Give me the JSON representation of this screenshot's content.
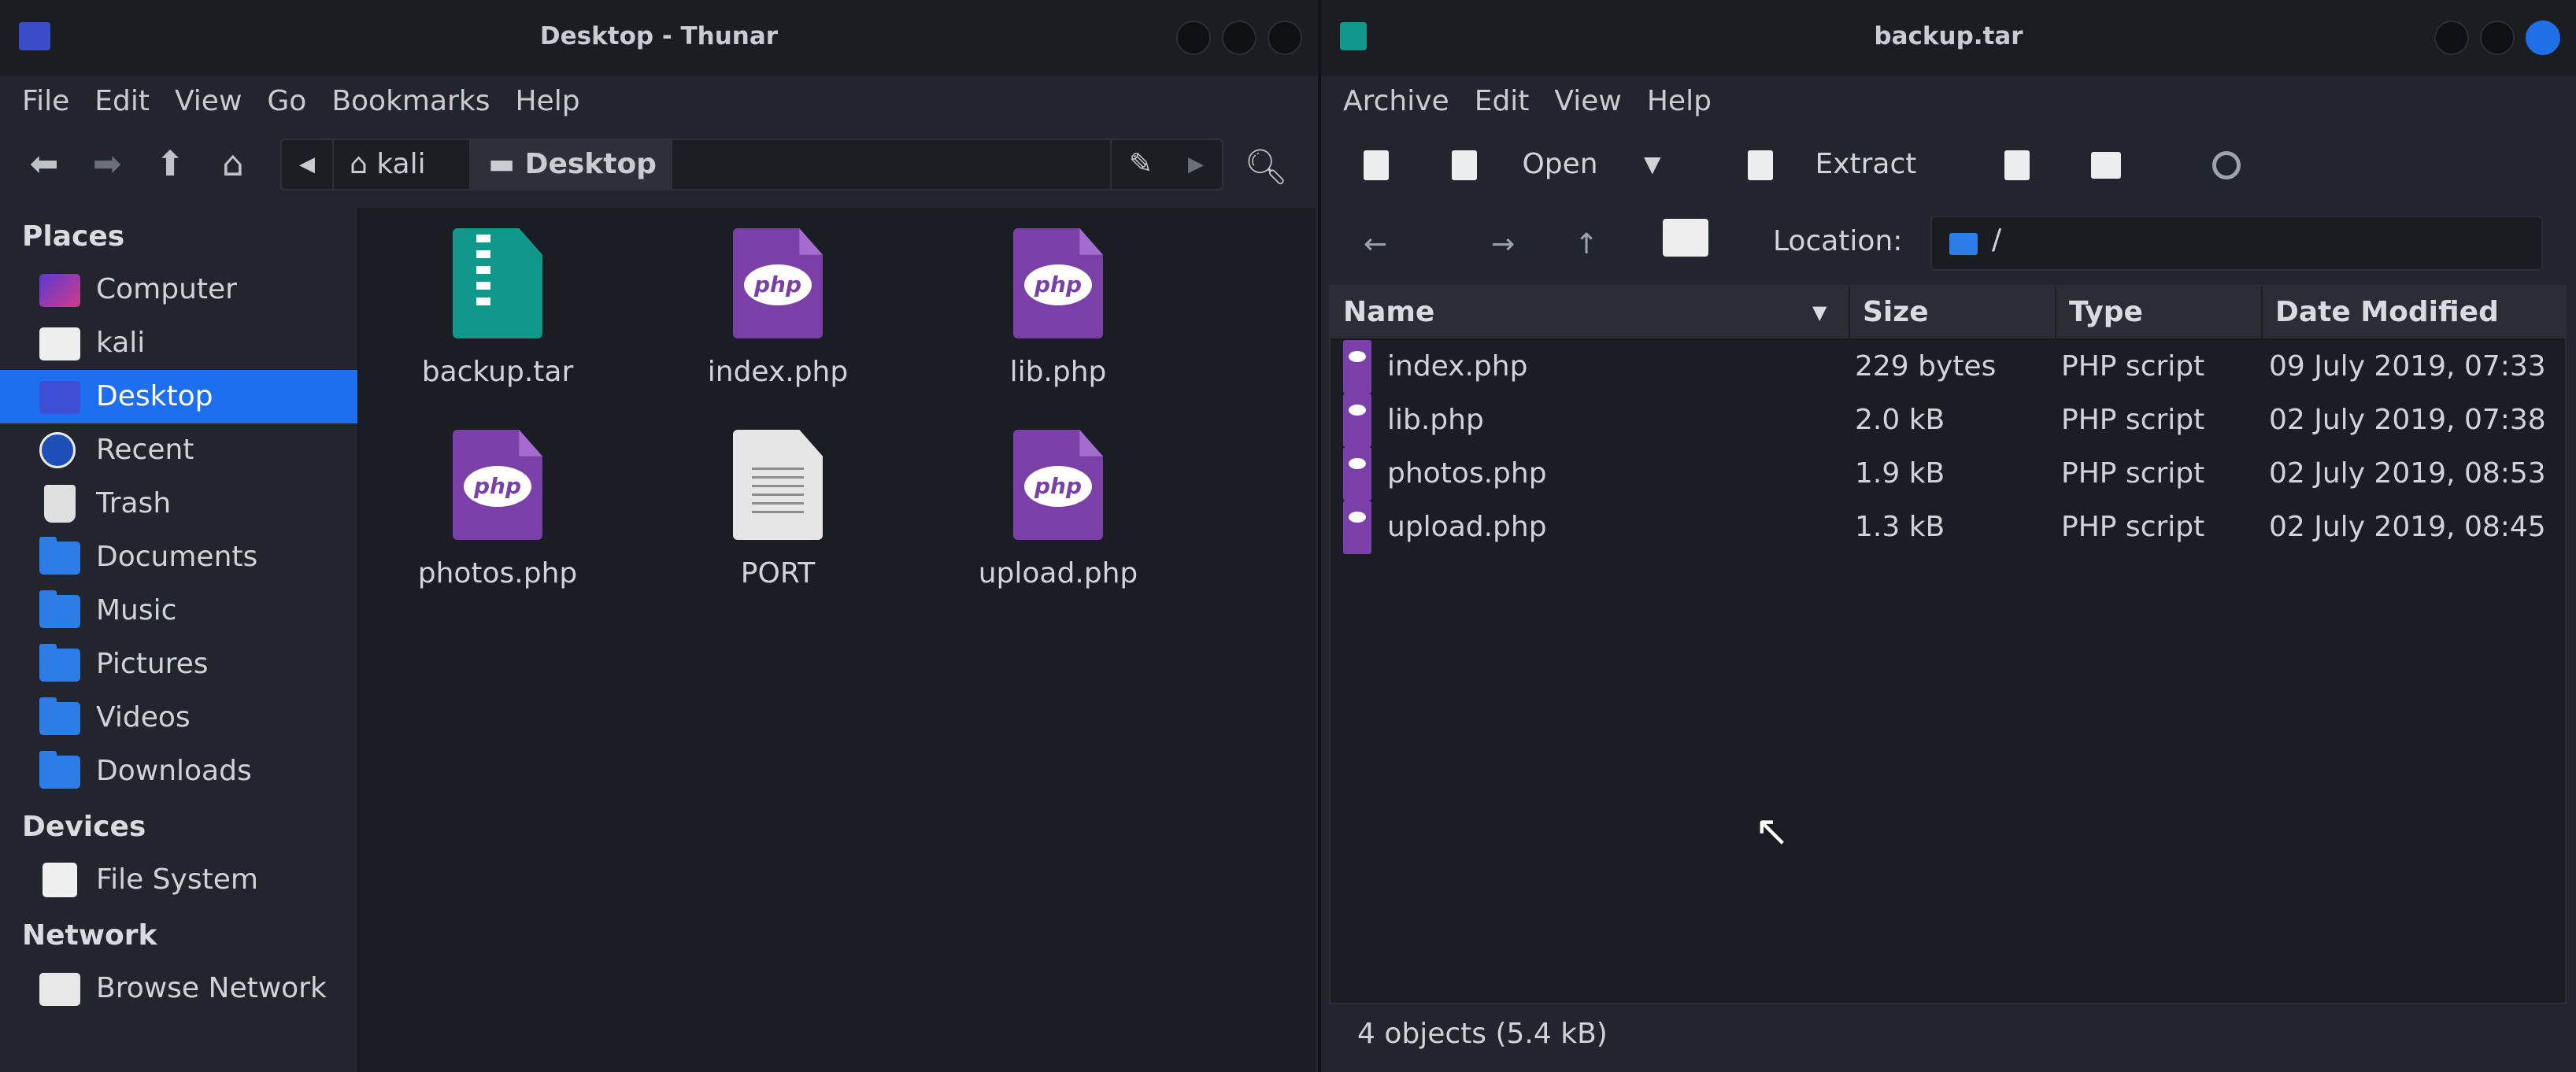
{
  "thunar": {
    "title": "Desktop - Thunar",
    "menu": [
      "File",
      "Edit",
      "View",
      "Go",
      "Bookmarks",
      "Help"
    ],
    "nav_icons": [
      "back-arrow-icon",
      "forward-arrow-icon",
      "up-arrow-icon",
      "home-icon"
    ],
    "path": {
      "home": "kali",
      "current": "Desktop"
    },
    "sidebar": {
      "places_header": "Places",
      "places": [
        {
          "label": "Computer",
          "icon": "computer-icon"
        },
        {
          "label": "kali",
          "icon": "home-folder-icon"
        },
        {
          "label": "Desktop",
          "icon": "desktop-icon",
          "selected": true
        },
        {
          "label": "Recent",
          "icon": "recent-icon"
        },
        {
          "label": "Trash",
          "icon": "trash-icon"
        },
        {
          "label": "Documents",
          "icon": "documents-folder-icon"
        },
        {
          "label": "Music",
          "icon": "music-folder-icon"
        },
        {
          "label": "Pictures",
          "icon": "pictures-folder-icon"
        },
        {
          "label": "Videos",
          "icon": "videos-folder-icon"
        },
        {
          "label": "Downloads",
          "icon": "downloads-folder-icon"
        }
      ],
      "devices_header": "Devices",
      "devices": [
        {
          "label": "File System",
          "icon": "drive-icon"
        }
      ],
      "network_header": "Network",
      "network": [
        {
          "label": "Browse Network",
          "icon": "network-icon"
        }
      ]
    },
    "files": [
      {
        "label": "backup.tar",
        "type": "archive"
      },
      {
        "label": "index.php",
        "type": "php"
      },
      {
        "label": "lib.php",
        "type": "php"
      },
      {
        "label": "photos.php",
        "type": "php"
      },
      {
        "label": "PORT",
        "type": "text"
      },
      {
        "label": "upload.php",
        "type": "php"
      }
    ]
  },
  "archiver": {
    "title": "backup.tar",
    "menu": [
      "Archive",
      "Edit",
      "View",
      "Help"
    ],
    "toolbar": {
      "open_label": "Open",
      "extract_label": "Extract"
    },
    "location_label": "Location:",
    "location_value": "/",
    "columns": [
      "Name",
      "Size",
      "Type",
      "Date Modified"
    ],
    "rows": [
      {
        "name": "index.php",
        "size": "229 bytes",
        "type": "PHP script",
        "date": "09 July 2019, 07:33"
      },
      {
        "name": "lib.php",
        "size": "2.0 kB",
        "type": "PHP script",
        "date": "02 July 2019, 07:38"
      },
      {
        "name": "photos.php",
        "size": "1.9 kB",
        "type": "PHP script",
        "date": "02 July 2019, 08:53"
      },
      {
        "name": "upload.php",
        "size": "1.3 kB",
        "type": "PHP script",
        "date": "02 July 2019, 08:45"
      }
    ],
    "status": "4 objects (5.4 kB)"
  },
  "colors": {
    "accent": "#1d6ff0",
    "php": "#7b3fa8",
    "archive": "#12988a"
  }
}
